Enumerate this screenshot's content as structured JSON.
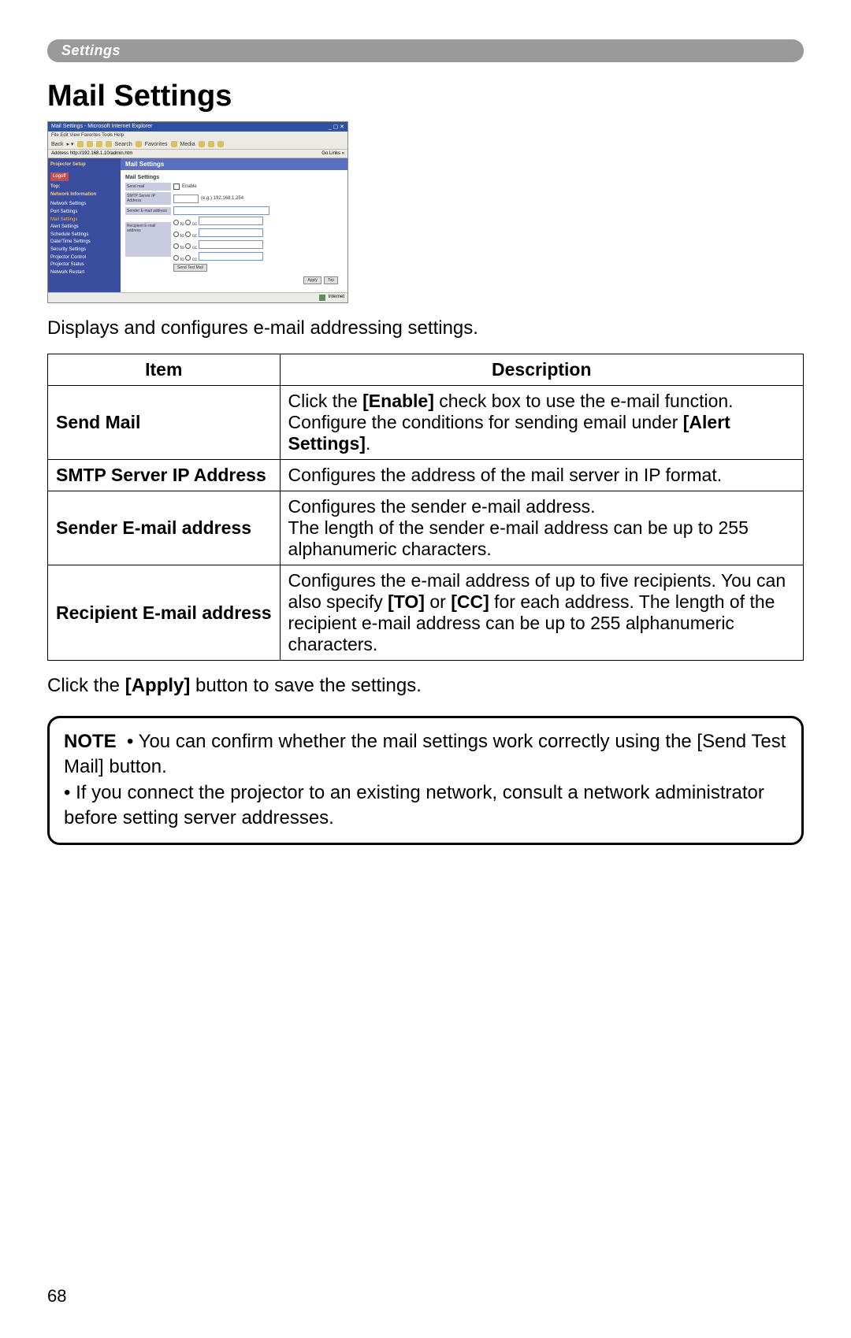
{
  "banner": {
    "label": "Settings"
  },
  "heading": "Mail Settings",
  "screenshot": {
    "window_title": "Mail Settings - Microsoft Internet Explorer",
    "menubar": "File  Edit  View  Favorites  Tools  Help",
    "toolbar_back": "Back",
    "toolbar_search": "Search",
    "toolbar_fav": "Favorites",
    "toolbar_media": "Media",
    "address_label": "Address",
    "address_value": "http://192.168.1.10/admin.htm",
    "go": "Go",
    "links": "Links",
    "sidebar": {
      "title": "Projector Setup",
      "logoff": "Logoff",
      "top": "Top:",
      "network_info": "Network Information",
      "items": [
        "Network Settings",
        "Port Settings",
        "Mail Settings",
        "Alert Settings",
        "Schedule Settings",
        "Date/Time Settings",
        "Security Settings",
        "Projector Control",
        "Projector Status",
        "Network Restart"
      ]
    },
    "main": {
      "header": "Mail Settings",
      "section_title": "Mail Settings",
      "rows": {
        "send_mail": "Send mail",
        "enable": "Enable",
        "smtp": "SMTP Server IP Address",
        "smtp_hint": "(e.g.) 192.168.1.254",
        "sender": "Sender E-mail address",
        "recipient": "Recipient E-mail address",
        "to": "to",
        "cc": "cc",
        "send_test": "Send Test Mail",
        "apply": "Apply",
        "top_btn": "Top"
      }
    },
    "status_internet": "Internet"
  },
  "intro": "Displays and configures e-mail addressing settings.",
  "table": {
    "headers": {
      "item": "Item",
      "desc": "Description"
    },
    "rows": [
      {
        "item": "Send Mail",
        "desc_pre": "Click the ",
        "desc_b1": "[Enable]",
        "desc_mid": " check box to use the e-mail function. Configure the conditions for sending email under ",
        "desc_b2": "[Alert Settings]",
        "desc_post": "."
      },
      {
        "item": "SMTP Server IP Address",
        "desc": "Configures the address of the mail server in IP format."
      },
      {
        "item": "Sender E-mail address",
        "desc": "Configures the sender e-mail address.\nThe length of the sender e-mail address can be up to 255 alphanumeric characters."
      },
      {
        "item": "Recipient E-mail address",
        "desc_pre": "Configures the e-mail address of up to five recipients. You can also specify ",
        "desc_b1": "[TO]",
        "desc_mid": " or ",
        "desc_b2": "[CC]",
        "desc_post": " for each address. The length of the recipient e-mail address can be up to 255 alphanumeric characters."
      }
    ]
  },
  "apply_line": {
    "pre": "Click the ",
    "bold": "[Apply]",
    "post": " button to save the settings."
  },
  "note": {
    "label": "NOTE",
    "bullet1": "• You can confirm whether the mail settings work correctly using the [Send Test Mail] button.",
    "bullet2": "• If you connect the projector to an existing network, consult a network administrator before setting server addresses."
  },
  "page_number": "68"
}
